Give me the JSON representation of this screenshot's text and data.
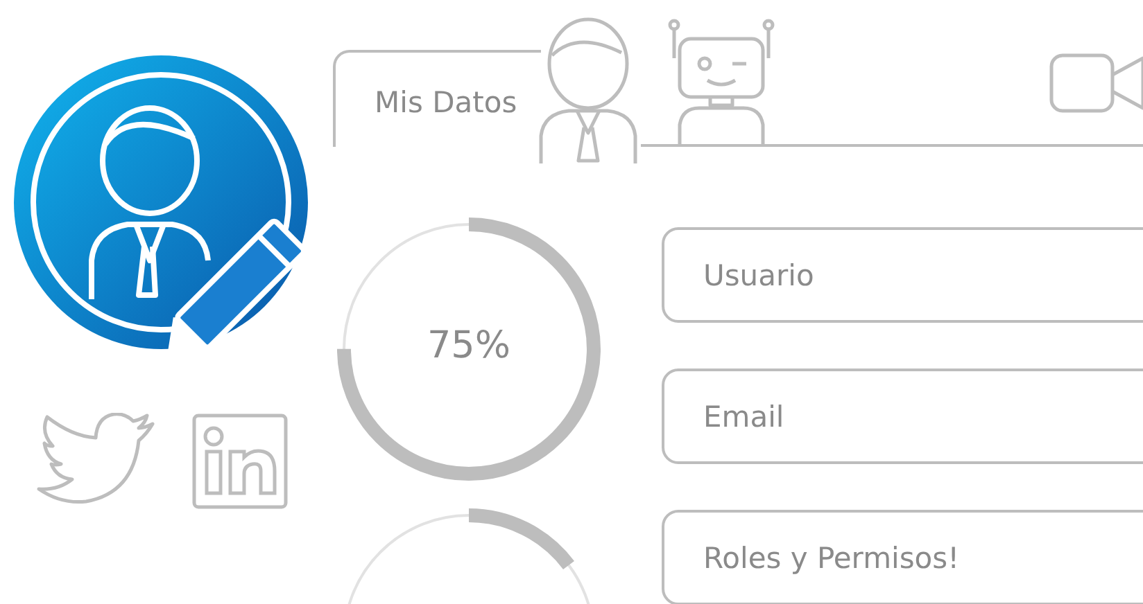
{
  "tab": {
    "label": "Mis Datos",
    "selected": true
  },
  "progress": {
    "label": "75%",
    "level": 0.75
  },
  "fields": [
    {
      "placeholder": "Usuario"
    },
    {
      "placeholder": "Email"
    },
    {
      "placeholder": "Roles y Permisos!"
    }
  ]
}
